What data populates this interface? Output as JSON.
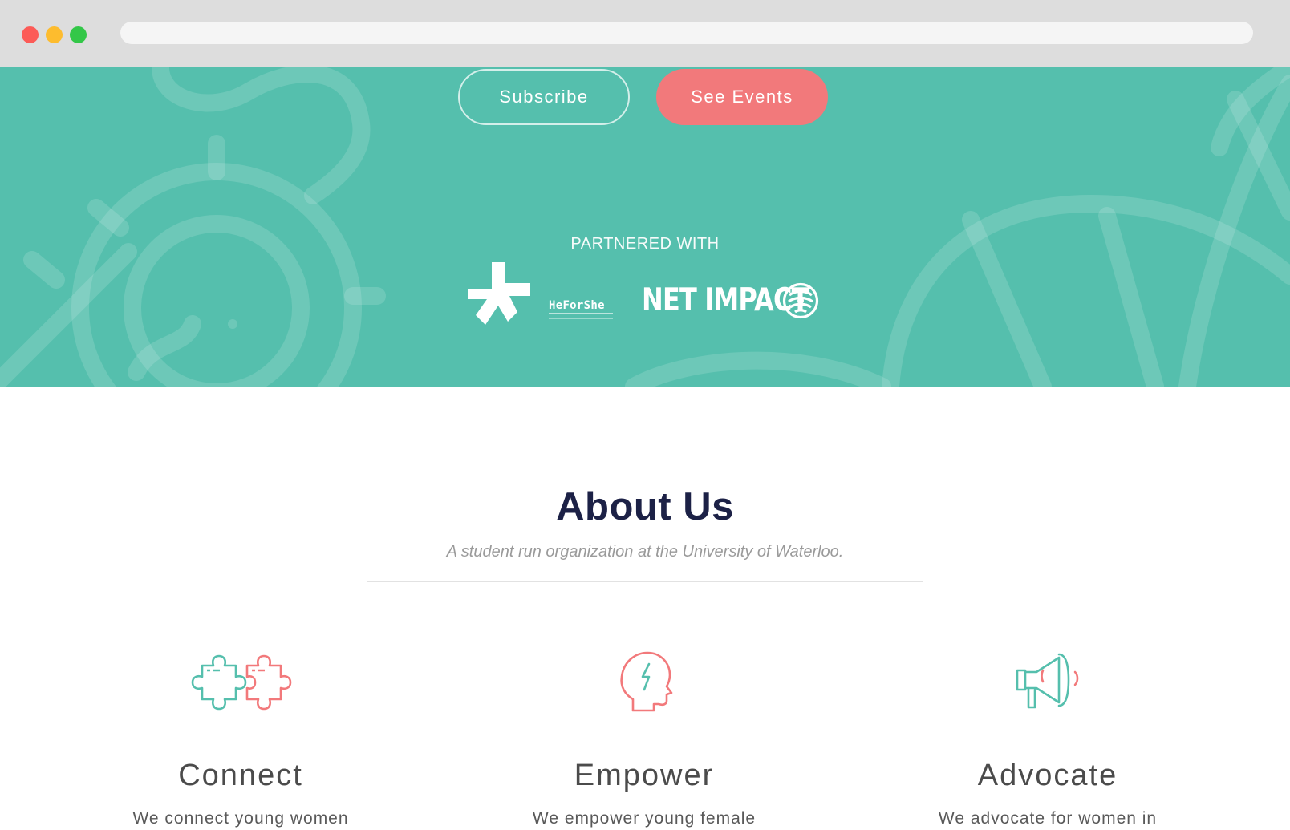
{
  "hero": {
    "subscribe_label": "Subscribe",
    "events_label": "See Events",
    "partnered_label": "PARTNERED WITH",
    "partners": {
      "heforshe": "HeForShe",
      "netimpact": "NET IMPACT"
    }
  },
  "about": {
    "title": "About Us",
    "subtitle": "A student run organization at the University of Waterloo."
  },
  "features": [
    {
      "icon": "puzzle-icon",
      "title": "Connect",
      "desc": "We connect young women"
    },
    {
      "icon": "head-lightning-icon",
      "title": "Empower",
      "desc": "We empower young female"
    },
    {
      "icon": "megaphone-icon",
      "title": "Advocate",
      "desc": "We advocate for women in"
    }
  ],
  "colors": {
    "hero_bg": "#55bfad",
    "accent_coral": "#f2797b",
    "heading_navy": "#1c2146"
  }
}
